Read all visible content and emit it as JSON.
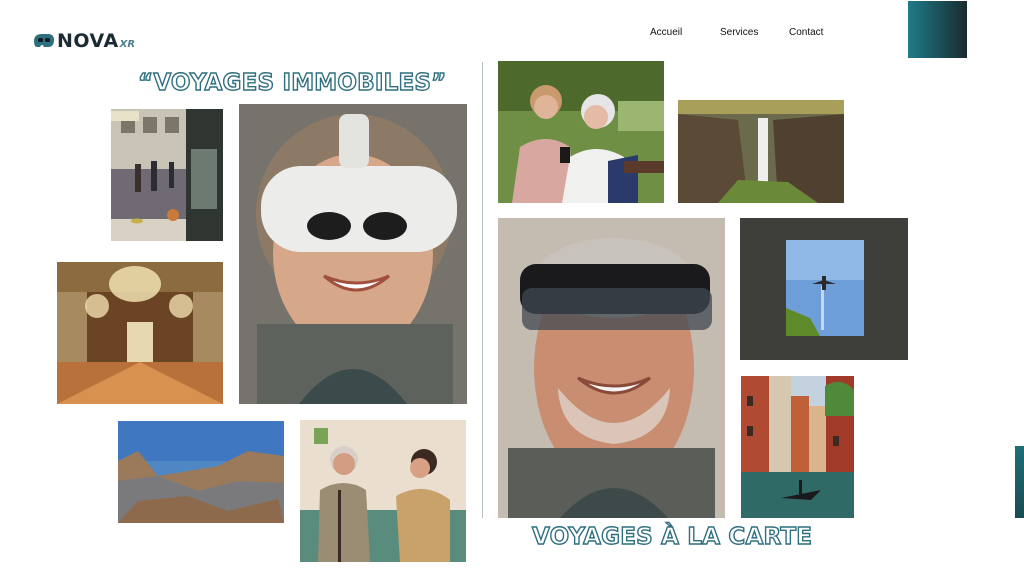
{
  "brand": {
    "name": "NOVA",
    "suffix": "XR",
    "colors": {
      "accent": "#2f6f80",
      "teal": "#1f7c87",
      "dark": "#1c2a33"
    }
  },
  "nav": {
    "items": [
      {
        "label": "Accueil"
      },
      {
        "label": "Services"
      },
      {
        "label": "Contact"
      }
    ]
  },
  "sections": {
    "left_title": "“VOYAGES IMMOBILES”",
    "right_title": "VOYAGES À LA CARTE"
  },
  "photos": [
    {
      "icon": "street-cafe-photo"
    },
    {
      "icon": "woman-vr-headset-photo"
    },
    {
      "icon": "hall-of-mirrors-photo"
    },
    {
      "icon": "canyon-landscape-photo"
    },
    {
      "icon": "caregiver-elderly-photo"
    },
    {
      "icon": "women-smartphone-photo"
    },
    {
      "icon": "waterfall-cliff-photo"
    },
    {
      "icon": "man-ar-headset-photo"
    },
    {
      "icon": "airplane-window-photo"
    },
    {
      "icon": "venice-canal-photo"
    }
  ]
}
